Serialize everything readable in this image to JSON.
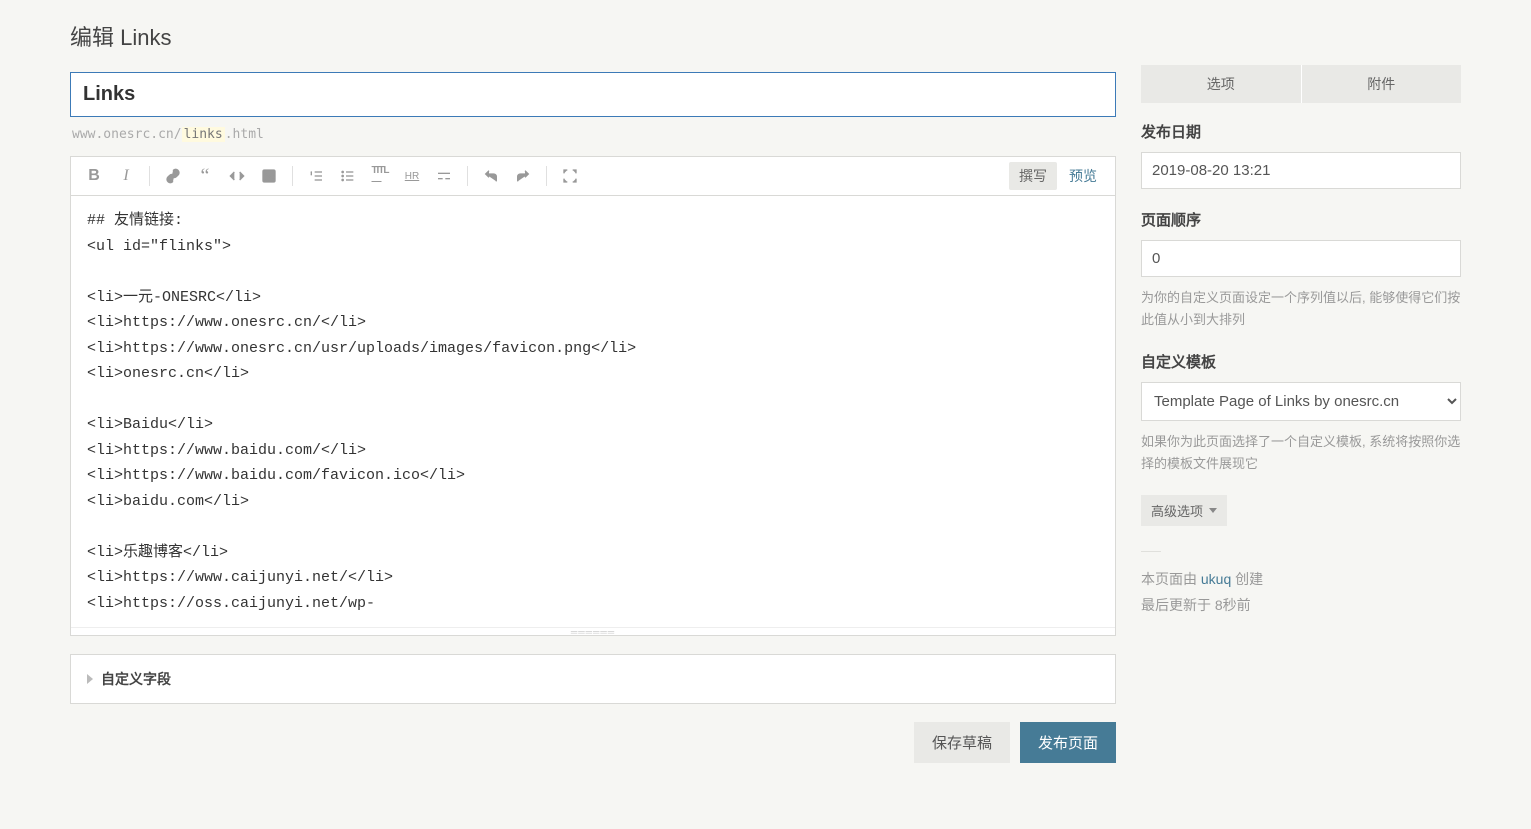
{
  "header": {
    "title": "编辑 Links"
  },
  "title_input": {
    "value": "Links"
  },
  "permalink": {
    "prefix": "www.onesrc.cn/",
    "slug": "links",
    "suffix": ".html"
  },
  "editor": {
    "mode_write": "撰写",
    "mode_preview": "预览",
    "content": "## 友情链接:\n<ul id=\"flinks\">\n\n<li>一元-ONESRC</li>\n<li>https://www.onesrc.cn/</li>\n<li>https://www.onesrc.cn/usr/uploads/images/favicon.png</li>\n<li>onesrc.cn</li>\n\n<li>Baidu</li>\n<li>https://www.baidu.com/</li>\n<li>https://www.baidu.com/favicon.ico</li>\n<li>baidu.com</li>\n\n<li>乐趣博客</li>\n<li>https://www.caijunyi.net/</li>\n<li>https://oss.caijunyi.net/wp-"
  },
  "custom_fields": {
    "label": "自定义字段"
  },
  "actions": {
    "save_draft": "保存草稿",
    "publish": "发布页面"
  },
  "sidebar": {
    "tabs": {
      "options": "选项",
      "attachments": "附件"
    },
    "publish_date": {
      "label": "发布日期",
      "value": "2019-08-20 13:21"
    },
    "page_order": {
      "label": "页面顺序",
      "value": "0",
      "help": "为你的自定义页面设定一个序列值以后, 能够使得它们按此值从小到大排列"
    },
    "template": {
      "label": "自定义模板",
      "selected": "Template Page of Links by onesrc.cn",
      "help": "如果你为此页面选择了一个自定义模板, 系统将按照你选择的模板文件展现它"
    },
    "advanced": "高级选项",
    "meta": {
      "created_prefix": "本页面由 ",
      "created_user": "ukuq",
      "created_suffix": " 创建",
      "updated": "最后更新于 8秒前"
    }
  }
}
